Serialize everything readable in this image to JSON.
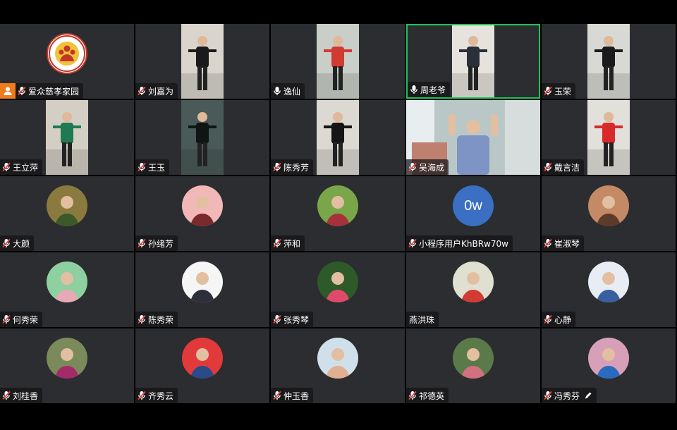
{
  "meeting": {
    "view": "gallery"
  },
  "participants": [
    {
      "name": "爱众慈孝家园",
      "type": "logo",
      "mic": "muted",
      "host": true
    },
    {
      "name": "刘嘉为",
      "type": "video",
      "mic": "muted",
      "bg": "#d9d5cc",
      "fg": "#1a1a1a"
    },
    {
      "name": "逸仙",
      "type": "video",
      "mic": "on",
      "bg": "#c9cec9",
      "fg": "#d23a34"
    },
    {
      "name": "周老爷",
      "type": "video",
      "mic": "on",
      "bg": "#e6e3de",
      "fg": "#2a2f3a",
      "active": true
    },
    {
      "name": "玉荣",
      "type": "video",
      "mic": "muted",
      "bg": "#d8d9d4",
      "fg": "#1b1b1b"
    },
    {
      "name": "王立萍",
      "type": "video",
      "mic": "muted",
      "bg": "#d4cfc4",
      "fg": "#1f7a52"
    },
    {
      "name": "王玉",
      "type": "video",
      "mic": "muted",
      "bg": "#4a5a58",
      "fg": "#0e1512"
    },
    {
      "name": "陈秀芳",
      "type": "video",
      "mic": "muted",
      "bg": "#dcd8d2",
      "fg": "#151515"
    },
    {
      "name": "吴海成",
      "type": "video",
      "mic": "muted",
      "bg": "#b9c8c6",
      "fg": "#7e94c5",
      "wide": true
    },
    {
      "name": "戴言洁",
      "type": "video",
      "mic": "muted",
      "bg": "#e2e0da",
      "fg": "#d72b2b"
    },
    {
      "name": "大颜",
      "type": "avatar",
      "mic": "muted",
      "c1": "#8a7a3e",
      "c2": "#3b5a2a"
    },
    {
      "name": "孙绪芳",
      "type": "avatar",
      "mic": "muted",
      "c1": "#f2b8b8",
      "c2": "#7a2a2a"
    },
    {
      "name": "萍和",
      "type": "avatar",
      "mic": "muted",
      "c1": "#7aa64a",
      "c2": "#a5323a"
    },
    {
      "name": "小程序用户KhBRw70w",
      "type": "initials",
      "mic": "muted",
      "initials": "0w"
    },
    {
      "name": "崔淑琴",
      "type": "avatar",
      "mic": "muted",
      "c1": "#c48a66",
      "c2": "#5e3a2a"
    },
    {
      "name": "何秀荣",
      "type": "avatar",
      "mic": "muted",
      "c1": "#8fd0a0",
      "c2": "#e8a9b6"
    },
    {
      "name": "陈秀荣",
      "type": "avatar",
      "mic": "muted",
      "c1": "#f5f5f5",
      "c2": "#2a2f3a"
    },
    {
      "name": "张秀琴",
      "type": "avatar",
      "mic": "muted",
      "c1": "#2e5a2a",
      "c2": "#e04a6a"
    },
    {
      "name": "燕洪珠",
      "type": "avatar",
      "mic": "none",
      "c1": "#e0e0d0",
      "c2": "#d23a34"
    },
    {
      "name": "心静",
      "type": "avatar",
      "mic": "muted",
      "c1": "#e8edf5",
      "c2": "#3a5fa0"
    },
    {
      "name": "刘桂香",
      "type": "avatar",
      "mic": "muted",
      "c1": "#7a8a5a",
      "c2": "#a52a6a"
    },
    {
      "name": "齐秀云",
      "type": "avatar",
      "mic": "muted",
      "c1": "#e23a3a",
      "c2": "#2a4a8a"
    },
    {
      "name": "仲玉香",
      "type": "avatar",
      "mic": "muted",
      "c1": "#cfe0ea",
      "c2": "#e0b090"
    },
    {
      "name": "祁德英",
      "type": "avatar",
      "mic": "muted",
      "c1": "#5a7a4a",
      "c2": "#d07080"
    },
    {
      "name": "冯秀芬",
      "type": "avatar",
      "mic": "muted",
      "c1": "#d8a0b8",
      "c2": "#2a6ac0",
      "edit": true
    }
  ],
  "colors": {
    "tile_bg": "#2b2d30",
    "active_border": "#22c05a",
    "host_badge": "#f07b1d",
    "initials_bg": "#3a6fc4"
  },
  "icons": {
    "muted": "mic-muted-icon",
    "on": "mic-icon",
    "host": "host-icon",
    "edit": "pencil-icon"
  }
}
